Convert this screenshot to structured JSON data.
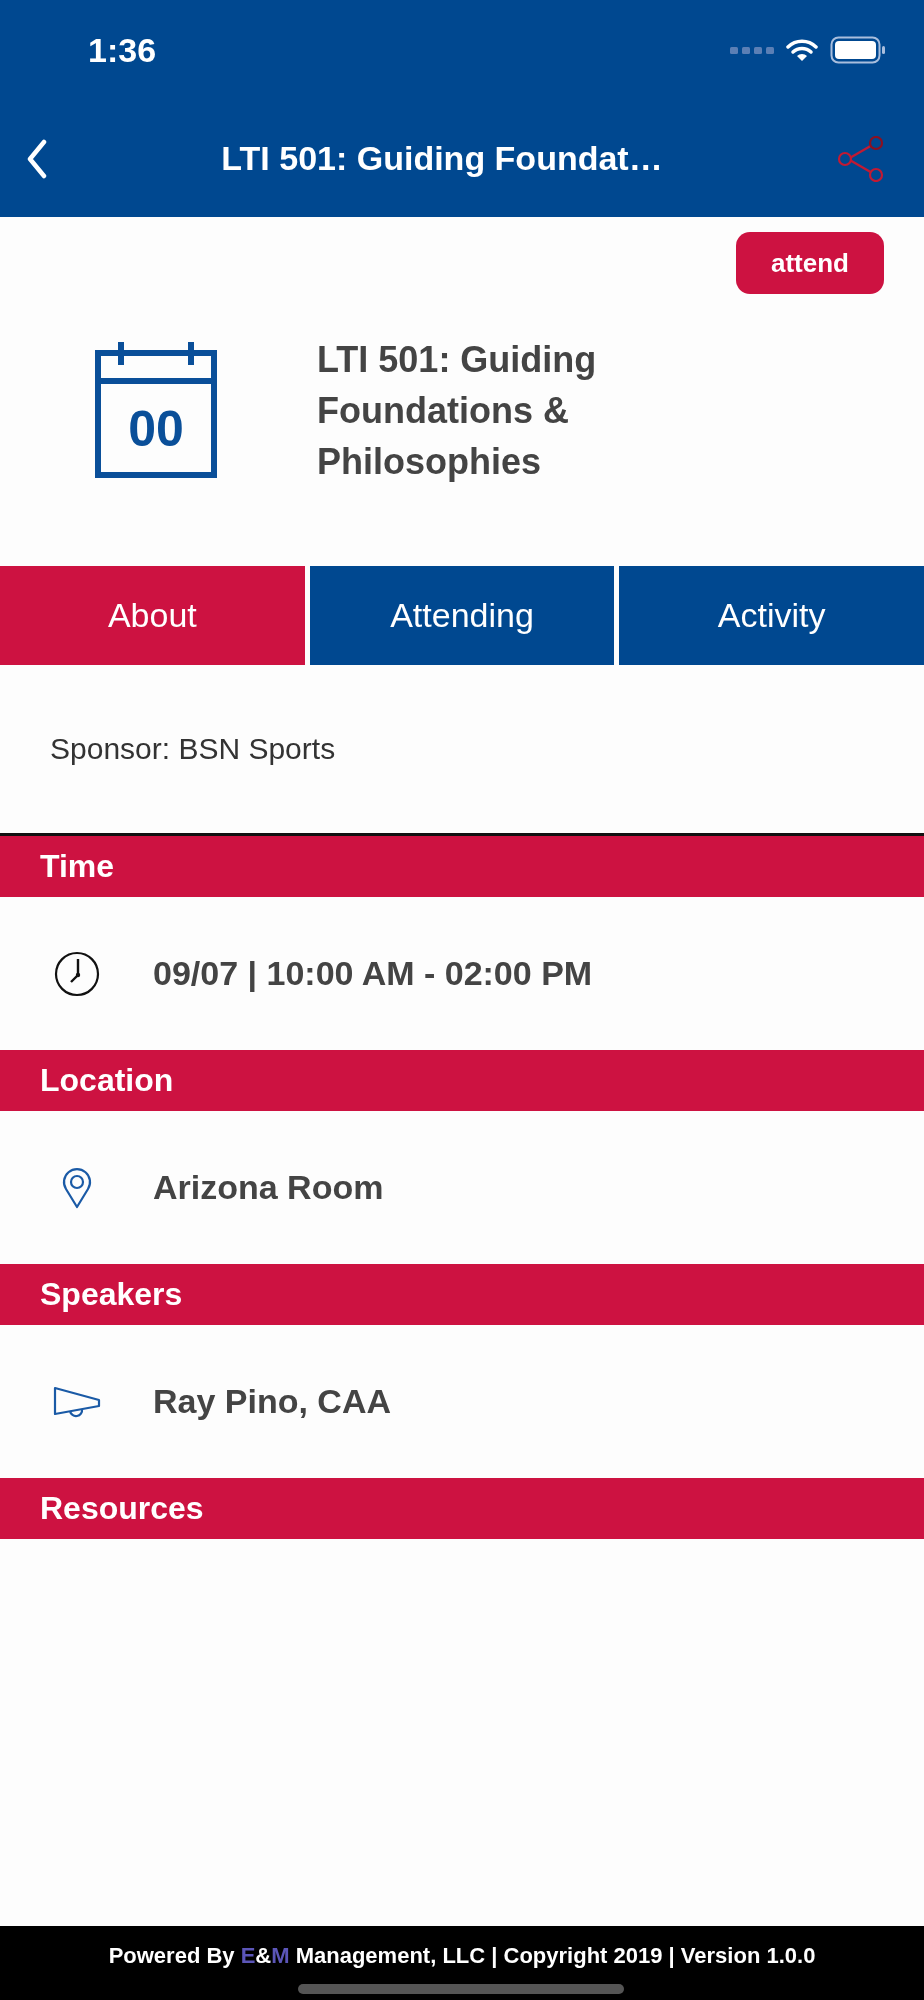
{
  "status_bar": {
    "time": "1:36"
  },
  "nav": {
    "title": "LTI 501: Guiding Foundat…"
  },
  "attend_button": {
    "label": "attend"
  },
  "event": {
    "title": "LTI 501: Guiding Foundations & Philosophies",
    "calendar_day": "00"
  },
  "tabs": [
    {
      "label": "About",
      "selected": true
    },
    {
      "label": "Attending",
      "selected": false
    },
    {
      "label": "Activity",
      "selected": false
    }
  ],
  "about": {
    "sponsor": "Sponsor: BSN Sports"
  },
  "sections": [
    {
      "title": "Time",
      "rows": [
        {
          "kind": "time",
          "text": "09/07 | 10:00 AM - 02:00 PM"
        }
      ]
    },
    {
      "title": "Location",
      "rows": [
        {
          "kind": "location",
          "text": "Arizona Room"
        }
      ]
    },
    {
      "title": "Speakers",
      "rows": [
        {
          "kind": "speaker",
          "text": "Ray Pino, CAA"
        }
      ]
    },
    {
      "title": "Resources"
    }
  ],
  "footer": {
    "prefix": "Powered By ",
    "brand_first": "E",
    "brand_middle": "&",
    "brand_last": "M",
    "rest": " Management, LLC | Copyright 2019 | Version 1.0.0"
  }
}
